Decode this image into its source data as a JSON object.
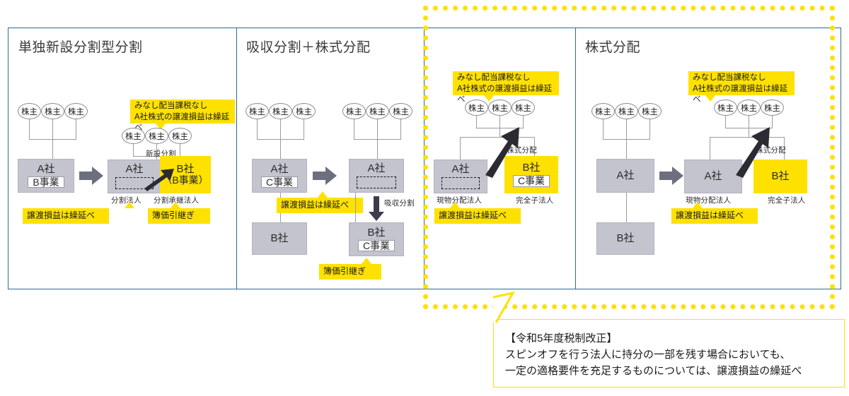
{
  "meta": {
    "colors": {
      "accent_yellow": "#ffe100",
      "panel_border": "#31688e",
      "company_gray": "#c3c4ce",
      "line_gray": "#9a9aa2",
      "arrow_dark": "#3c3c4a"
    }
  },
  "panels": [
    {
      "id": "p1",
      "title": "単独新設分割型分割",
      "before": {
        "holders": [
          "株主",
          "株主",
          "株主"
        ],
        "company": {
          "name": "A社",
          "business": "B事業"
        }
      },
      "after": {
        "holders": [
          "株主",
          "株主",
          "株主"
        ],
        "top_tag": "みなし配当課税なし\nA社株式の譲渡損益は繰延べ",
        "split_label": "新設分割",
        "left_company": {
          "name": "A社",
          "role": "分割法人",
          "tag": "譲渡損益は繰延べ"
        },
        "right_company": {
          "name": "B社",
          "business": "（B事業）",
          "role": "分割承継法人",
          "tag": "簿価引継ぎ"
        }
      }
    },
    {
      "id": "p2",
      "title": "吸収分割＋株式分配",
      "before": {
        "holders": [
          "株主",
          "株主",
          "株主"
        ],
        "parent": {
          "name": "A社",
          "business": "C事業"
        },
        "sub": {
          "name": "B社"
        },
        "tag": "譲渡損益は繰延べ"
      },
      "after": {
        "holders": [
          "株主",
          "株主",
          "株主"
        ],
        "parent": {
          "name": "A社"
        },
        "transfer_label": "吸収分割",
        "sub": {
          "name": "B社",
          "business": "C事業"
        },
        "tag": "簿価引継ぎ"
      }
    },
    {
      "id": "p3",
      "title": "",
      "after": {
        "holders": [
          "株主",
          "株主",
          "株主"
        ],
        "top_tag": "みなし配当課税なし\nA社株式の譲渡損益は繰延べ",
        "distribution_label": "株式分配",
        "left_company": {
          "name": "A社",
          "role": "現物分配法人",
          "tag": "譲渡損益は繰延べ"
        },
        "right_company": {
          "name": "B社",
          "business": "C事業",
          "role": "完全子法人"
        }
      }
    },
    {
      "id": "p4",
      "title": "株式分配",
      "before": {
        "holders": [
          "株主",
          "株主",
          "株主"
        ],
        "parent": {
          "name": "A社"
        },
        "sub": {
          "name": "B社"
        }
      },
      "after": {
        "holders": [
          "株主",
          "株主",
          "株主"
        ],
        "top_tag": "みなし配当課税なし\nA社株式の譲渡損益は繰延べ",
        "distribution_label": "株式分配",
        "left_company": {
          "name": "A社",
          "role": "現物分配法人",
          "tag": "譲渡損益は繰延べ"
        },
        "right_company": {
          "name": "B社",
          "role": "完全子法人"
        }
      }
    }
  ],
  "note": {
    "heading": "【令和5年度税制改正】",
    "body": "スピンオフを行う法人に持分の一部を残す場合においても、\n一定の適格要件を充足するものについては、譲渡損益の繰延べ",
    "full": "【令和5年度税制改正】\nスピンオフを行う法人に持分の一部を残す場合においても、\n一定の適格要件を充足するものについては、譲渡損益の繰延べ"
  }
}
